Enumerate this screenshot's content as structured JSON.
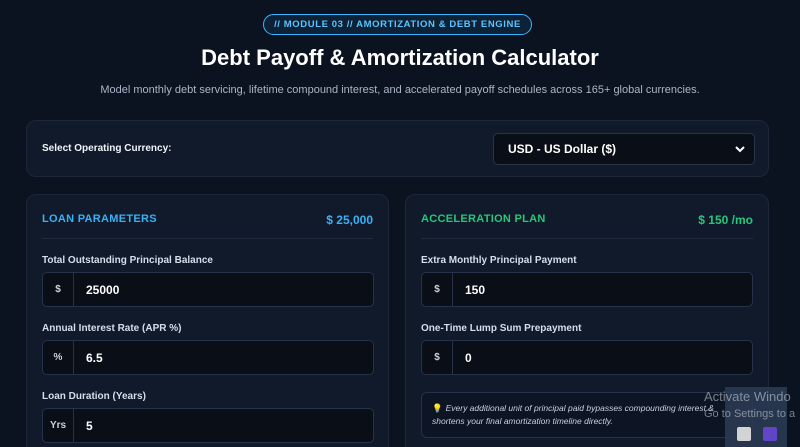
{
  "header": {
    "badge": "// MODULE 03 // AMORTIZATION & DEBT ENGINE",
    "title": "Debt Payoff & Amortization Calculator",
    "subtitle": "Model monthly debt servicing, lifetime compound interest, and accelerated payoff schedules across 165+ global currencies."
  },
  "currency": {
    "label": "Select Operating Currency:",
    "selected": "USD - US Dollar ($)"
  },
  "loan": {
    "title": "LOAN PARAMETERS",
    "summary": "$ 25,000",
    "principal_label": "Total Outstanding Principal Balance",
    "principal_prefix": "$",
    "principal_value": "25000",
    "rate_label": "Annual Interest Rate (APR %)",
    "rate_prefix": "%",
    "rate_value": "6.5",
    "duration_label": "Loan Duration (Years)",
    "duration_prefix": "Yrs",
    "duration_value": "5"
  },
  "acceleration": {
    "title": "ACCELERATION PLAN",
    "summary": "$ 150 /mo",
    "extra_label": "Extra Monthly Principal Payment",
    "extra_prefix": "$",
    "extra_value": "150",
    "lump_label": "One-Time Lump Sum Prepayment",
    "lump_prefix": "$",
    "lump_value": "0",
    "tip_text": "Every additional unit of principal paid bypasses compounding interest & shortens your final amortization timeline directly."
  },
  "overlay": {
    "activate_line1": "Activate Windo",
    "activate_line2": "Go to Settings to a"
  },
  "colors": {
    "accent_blue": "#3ab0f5",
    "accent_green": "#27c77a",
    "background": "#0b1220"
  }
}
